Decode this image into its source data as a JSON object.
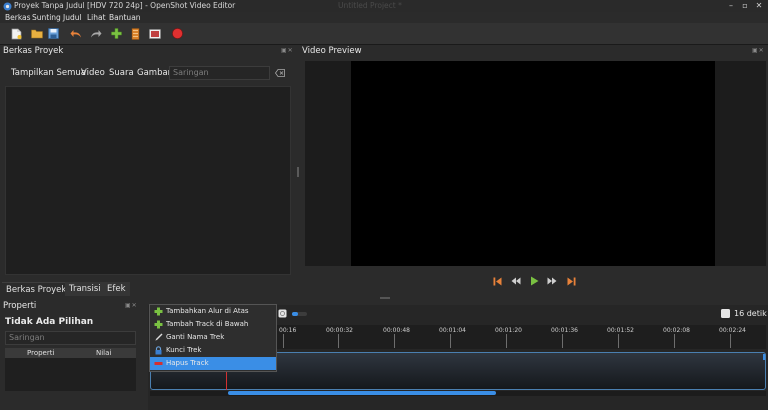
{
  "window": {
    "title": "Proyek Tanpa Judul [HDV 720 24p] - OpenShot Video Editor",
    "ghost_title": "Untitled Project *"
  },
  "menubar": {
    "items": [
      {
        "label": "Berkas"
      },
      {
        "label": "Sunting"
      },
      {
        "label": "Judul"
      },
      {
        "label": "Lihat"
      },
      {
        "label": "Bantuan"
      }
    ]
  },
  "toolbar": {
    "buttons": [
      {
        "icon": "new-project-icon"
      },
      {
        "icon": "open-project-icon"
      },
      {
        "icon": "save-project-icon"
      },
      {
        "icon": "undo-icon"
      },
      {
        "icon": "redo-icon"
      },
      {
        "icon": "import-files-icon"
      },
      {
        "icon": "choose-profile-icon"
      },
      {
        "icon": "fullscreen-icon"
      },
      {
        "icon": "export-video-icon"
      }
    ]
  },
  "project_files": {
    "title": "Berkas Proyek",
    "tabs": [
      {
        "label": "Tampilkan Semua",
        "active": true
      },
      {
        "label": "Video"
      },
      {
        "label": "Suara"
      },
      {
        "label": "Gambar"
      }
    ],
    "filter_placeholder": "Saringan"
  },
  "video_preview": {
    "title": "Video Preview",
    "controls": [
      "jump-start-icon",
      "rewind-icon",
      "play-icon",
      "fast-forward-icon",
      "jump-end-icon"
    ]
  },
  "bottom_tabs": [
    {
      "label": "Berkas Proyek",
      "active": true
    },
    {
      "label": "Transisi"
    },
    {
      "label": "Efek"
    }
  ],
  "properties": {
    "title": "Properti",
    "no_selection": "Tidak Ada Pilihan",
    "filter_placeholder": "Saringan",
    "columns": [
      "Properti",
      "Nilai"
    ]
  },
  "timeline": {
    "duration_label": "16 detik",
    "ruler_labels": [
      "00:16",
      "00:00:32",
      "00:00:48",
      "00:01:04",
      "00:01:20",
      "00:01:36",
      "00:01:52",
      "00:02:08",
      "00:02:24"
    ]
  },
  "context_menu": {
    "items": [
      {
        "label": "Tambahkan Alur di Atas",
        "icon": "plus-icon"
      },
      {
        "label": "Tambah Track di Bawah",
        "icon": "plus-icon"
      },
      {
        "label": "Ganti Nama Trek",
        "icon": "rename-icon"
      },
      {
        "label": "Kunci Trek",
        "icon": "lock-icon"
      },
      {
        "label": "Hapus Track",
        "icon": "minus-icon",
        "highlighted": true
      }
    ]
  },
  "colors": {
    "accent_blue": "#3a8ee6",
    "playhead_red": "#d43030",
    "transport_orange": "#e8823a",
    "play_green": "#7ac142"
  }
}
